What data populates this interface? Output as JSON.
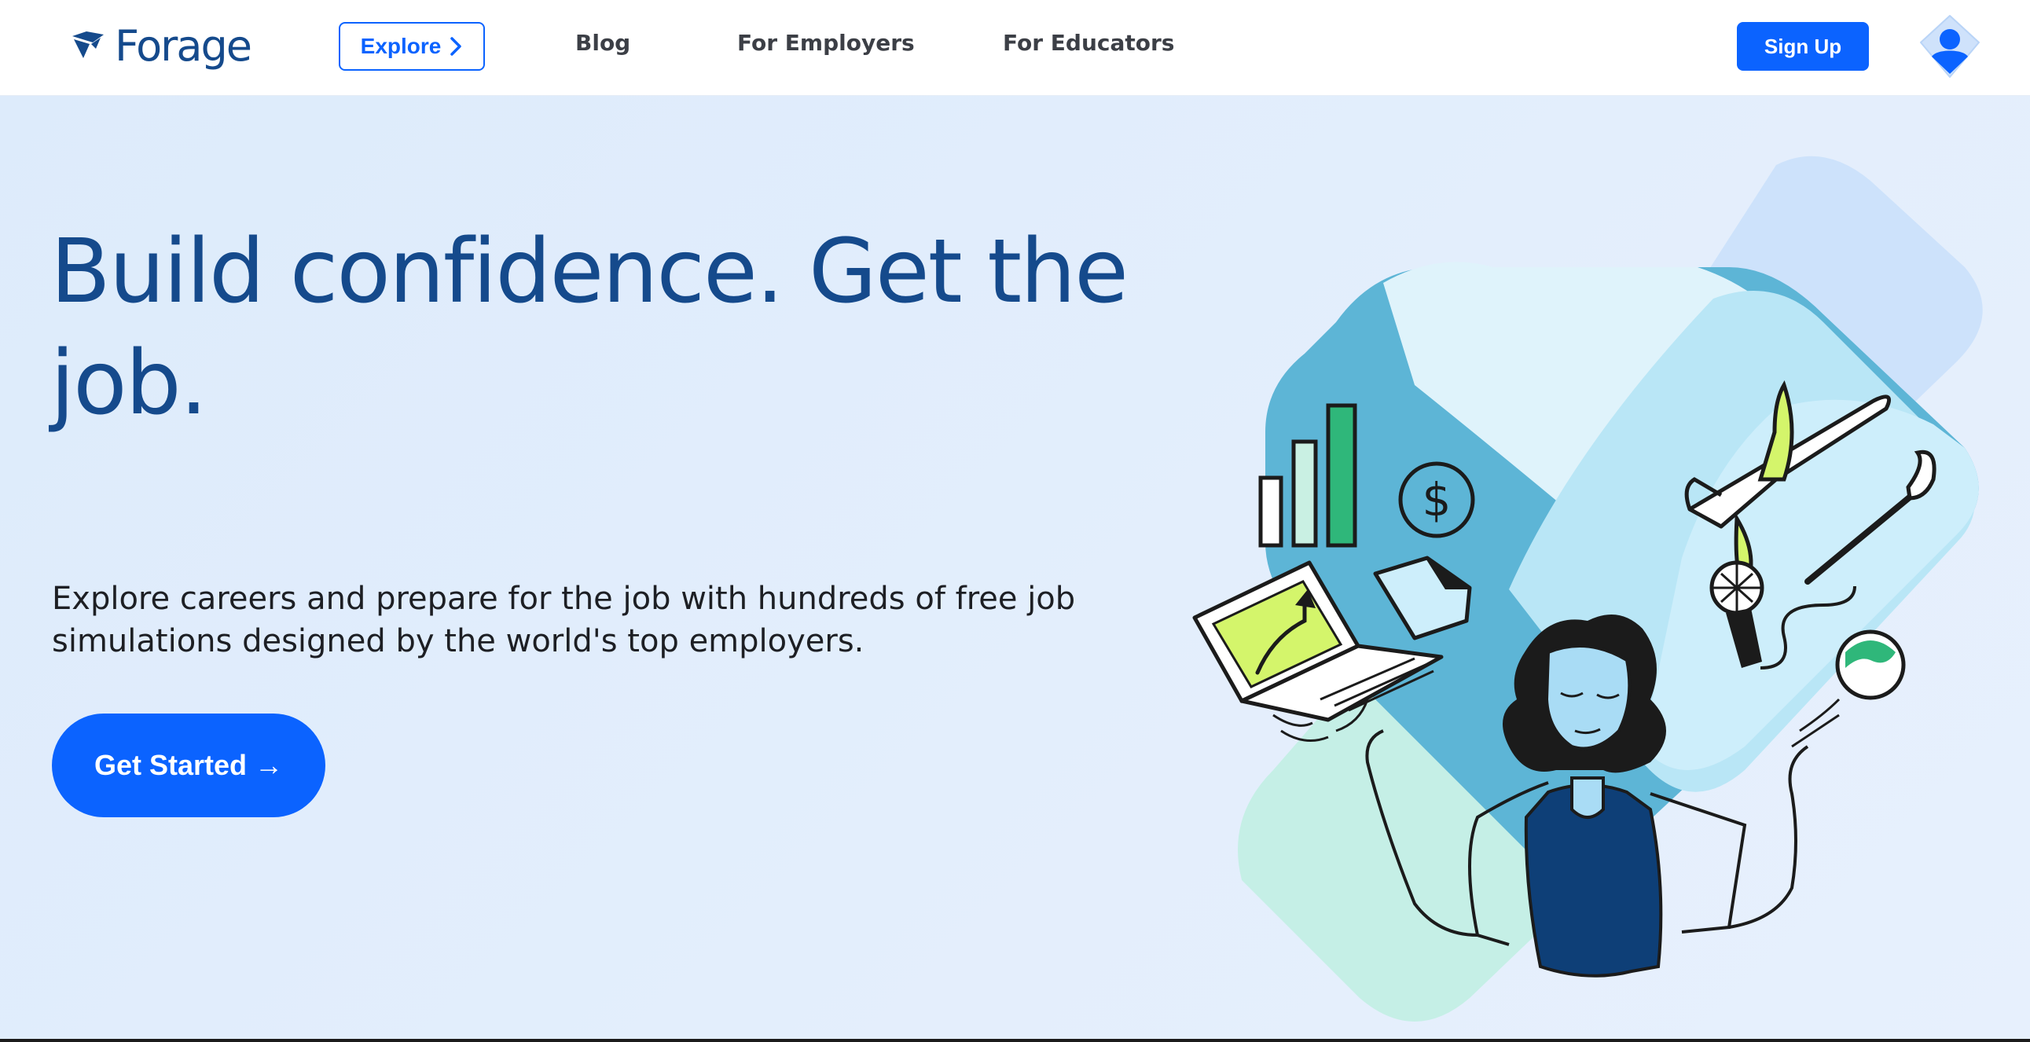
{
  "header": {
    "logo_text": "Forage",
    "explore_label": "Explore",
    "nav": [
      {
        "label": "Blog"
      },
      {
        "label": "For Employers"
      },
      {
        "label": "For Educators"
      }
    ],
    "signup_label": "Sign Up"
  },
  "hero": {
    "headline": "Build confidence. Get the job.",
    "subtext": "Explore careers and prepare for the job with hundreds of free job simulations designed by the world's top employers.",
    "cta_label": "Get Started →"
  },
  "icons": {
    "logo": "forage-logo-icon",
    "explore_chevron": "chevron-right-icon",
    "avatar": "user-avatar-icon"
  },
  "colors": {
    "brand_blue": "#0b63ff",
    "heading_blue": "#154a8c",
    "hero_bg": "#e1edfc",
    "accent_green": "#2fb77a",
    "accent_lime": "#d4f56b"
  }
}
